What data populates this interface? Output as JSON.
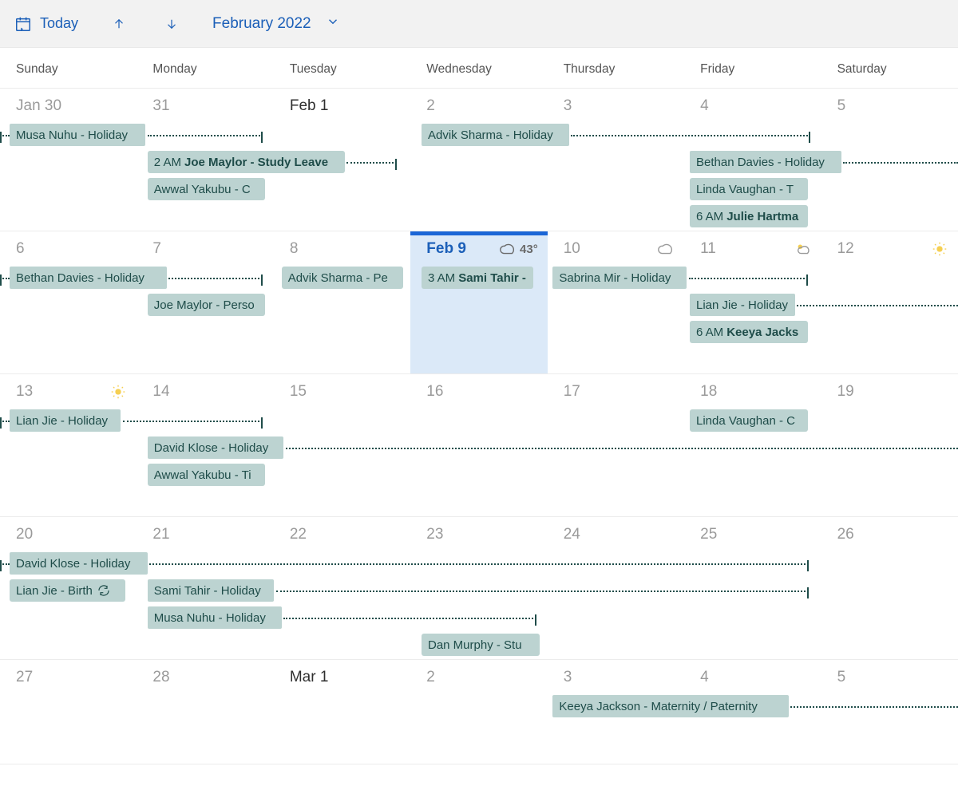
{
  "toolbar": {
    "today_label": "Today",
    "month_label": "February 2022"
  },
  "dow": [
    "Sunday",
    "Monday",
    "Tuesday",
    "Wednesday",
    "Thursday",
    "Friday",
    "Saturday"
  ],
  "week0": {
    "d0": "Jan 30",
    "d1": "31",
    "d2": "Feb 1",
    "d3": "2",
    "d4": "3",
    "d5": "4",
    "d6": "5",
    "ev_musa": "Musa Nuhu - Holiday",
    "ev_joe_time": "2 AM",
    "ev_joe": "Joe Maylor - Study Leave",
    "ev_awwal": "Awwal Yakubu - C",
    "ev_advik": "Advik Sharma - Holiday",
    "ev_bethan": "Bethan Davies - Holiday",
    "ev_linda": "Linda Vaughan - T",
    "ev_julie_time": "6 AM",
    "ev_julie": "Julie Hartma"
  },
  "week1": {
    "d0": "6",
    "d1": "7",
    "d2": "8",
    "d3": "Feb 9",
    "d3_temp": "43°",
    "d4": "10",
    "d5": "11",
    "d6": "12",
    "ev_bethan": "Bethan Davies - Holiday",
    "ev_joe": "Joe Maylor - Perso",
    "ev_advik": "Advik Sharma - Pe",
    "ev_sami_time": "3 AM",
    "ev_sami": "Sami Tahir -",
    "ev_sabrina": "Sabrina Mir - Holiday",
    "ev_lian": "Lian Jie - Holiday",
    "ev_keeya_time": "6 AM",
    "ev_keeya": "Keeya Jacks"
  },
  "week2": {
    "d0": "13",
    "d1": "14",
    "d2": "15",
    "d3": "16",
    "d4": "17",
    "d5": "18",
    "d6": "19",
    "ev_lian": "Lian Jie - Holiday",
    "ev_david": "David Klose - Holiday",
    "ev_awwal": "Awwal Yakubu - Ti",
    "ev_linda": "Linda Vaughan - C"
  },
  "week3": {
    "d0": "20",
    "d1": "21",
    "d2": "22",
    "d3": "23",
    "d4": "24",
    "d5": "25",
    "d6": "26",
    "ev_david": "David Klose - Holiday",
    "ev_lian": "Lian Jie - Birth",
    "ev_sami": "Sami Tahir - Holiday",
    "ev_musa": "Musa Nuhu - Holiday",
    "ev_dan": "Dan Murphy - Stu"
  },
  "week4": {
    "d0": "27",
    "d1": "28",
    "d2": "Mar 1",
    "d3": "2",
    "d4": "3",
    "d5": "4",
    "d6": "5",
    "ev_keeya": "Keeya Jackson - Maternity / Paternity"
  }
}
